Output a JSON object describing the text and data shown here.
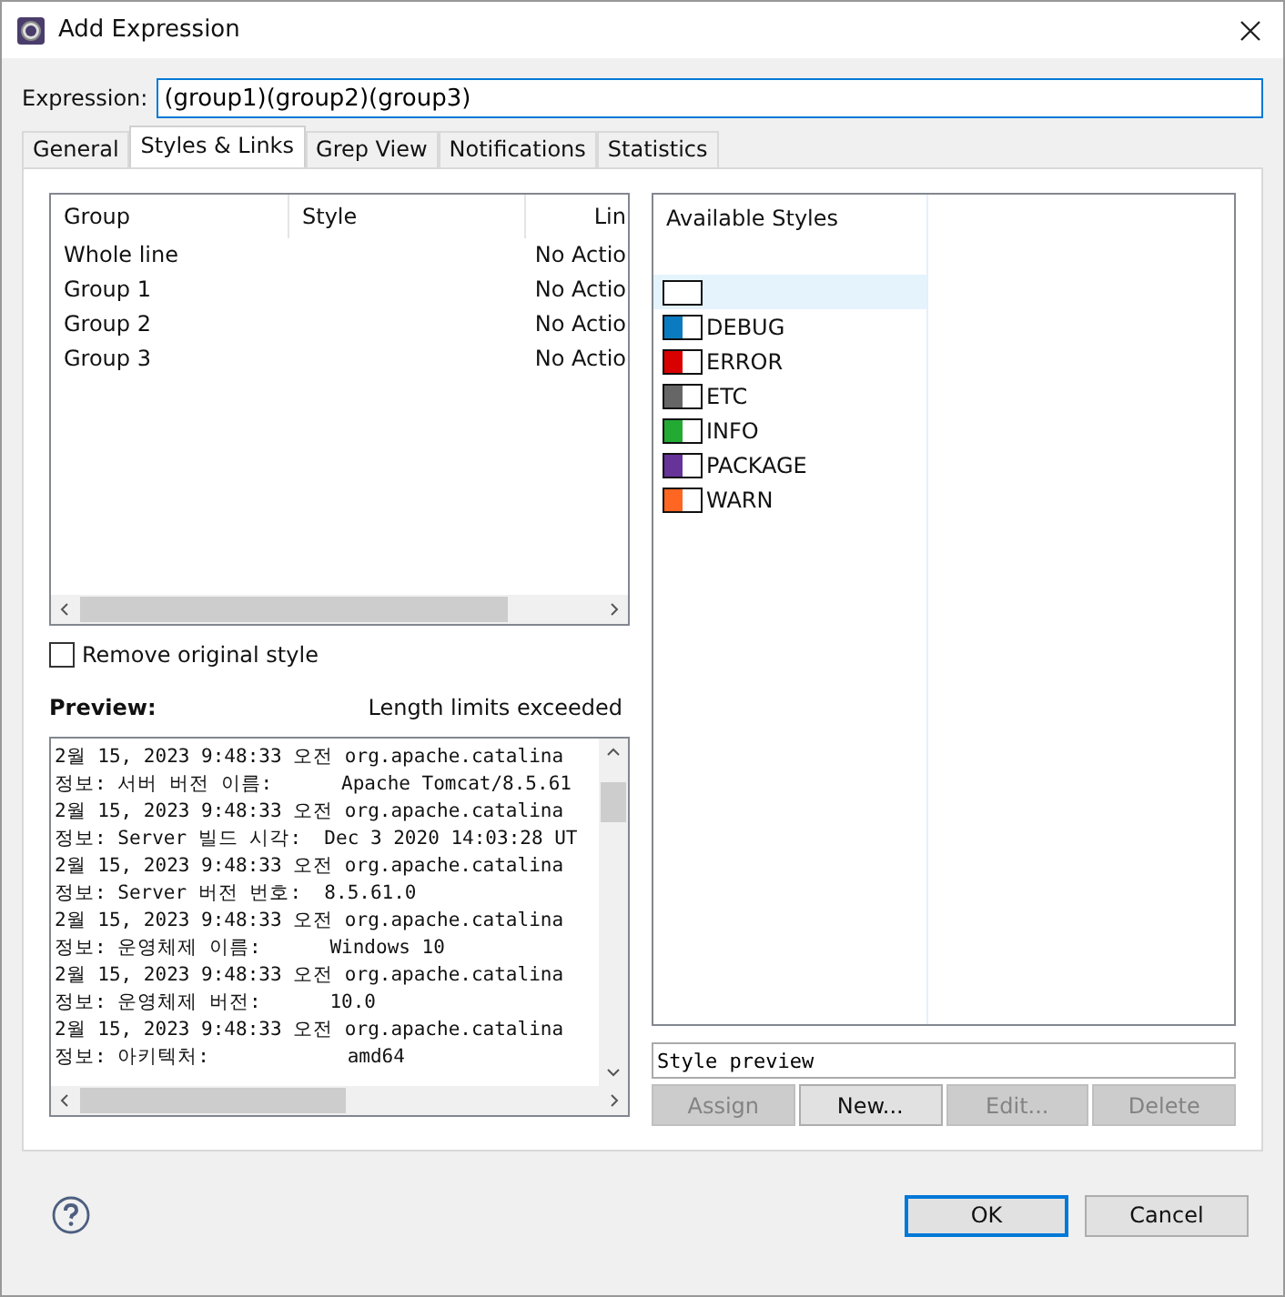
{
  "window": {
    "title": "Add Expression"
  },
  "expression": {
    "label": "Expression:",
    "value": "(group1)(group2)(group3)"
  },
  "tabs": [
    {
      "label": "General",
      "selected": false
    },
    {
      "label": "Styles & Links",
      "selected": true
    },
    {
      "label": "Grep View",
      "selected": false
    },
    {
      "label": "Notifications",
      "selected": false
    },
    {
      "label": "Statistics",
      "selected": false
    }
  ],
  "groups_table": {
    "columns": [
      "Group",
      "Style",
      "Lin"
    ],
    "rows": [
      {
        "group": "Whole line",
        "link": "No Actio"
      },
      {
        "group": "Group 1",
        "link": "No Actio"
      },
      {
        "group": "Group 2",
        "link": "No Actio"
      },
      {
        "group": "Group 3",
        "link": "No Actio"
      }
    ]
  },
  "remove_original_style": {
    "label": "Remove original style",
    "checked": false
  },
  "preview": {
    "label": "Preview:",
    "status": "Length limits exceeded",
    "lines": [
      "2월 15, 2023 9:48:33 오전 org.apache.catalina",
      "정보: 서버 버전 이름:      Apache Tomcat/8.5.61",
      "2월 15, 2023 9:48:33 오전 org.apache.catalina",
      "정보: Server 빌드 시각:  Dec 3 2020 14:03:28 UT",
      "2월 15, 2023 9:48:33 오전 org.apache.catalina",
      "정보: Server 버전 번호:  8.5.61.0",
      "2월 15, 2023 9:48:33 오전 org.apache.catalina",
      "정보: 운영체제 이름:      Windows 10",
      "2월 15, 2023 9:48:33 오전 org.apache.catalina",
      "정보: 운영체제 버전:      10.0",
      "2월 15, 2023 9:48:33 오전 org.apache.catalina",
      "정보: 아키텍처:            amd64"
    ]
  },
  "styles": {
    "header": "Available Styles",
    "items": [
      {
        "selected": true
      },
      {
        "name": "DEBUG",
        "color": "#0a7bc0",
        "selected": false
      },
      {
        "name": "ERROR",
        "color": "#d90000",
        "selected": false
      },
      {
        "name": "ETC",
        "color": "#666666",
        "selected": false
      },
      {
        "name": "INFO",
        "color": "#22aa33",
        "selected": false
      },
      {
        "name": "PACKAGE",
        "color": "#663399",
        "selected": false
      },
      {
        "name": "WARN",
        "color": "#ff6622",
        "selected": false
      }
    ]
  },
  "style_preview": {
    "value": "Style preview"
  },
  "style_buttons": [
    {
      "label": "Assign",
      "disabled": true
    },
    {
      "label": "New...",
      "disabled": false
    },
    {
      "label": "Edit...",
      "disabled": true
    },
    {
      "label": "Delete",
      "disabled": true
    }
  ],
  "dialog_buttons": [
    {
      "label": "OK",
      "default": true
    },
    {
      "label": "Cancel",
      "default": false
    }
  ]
}
